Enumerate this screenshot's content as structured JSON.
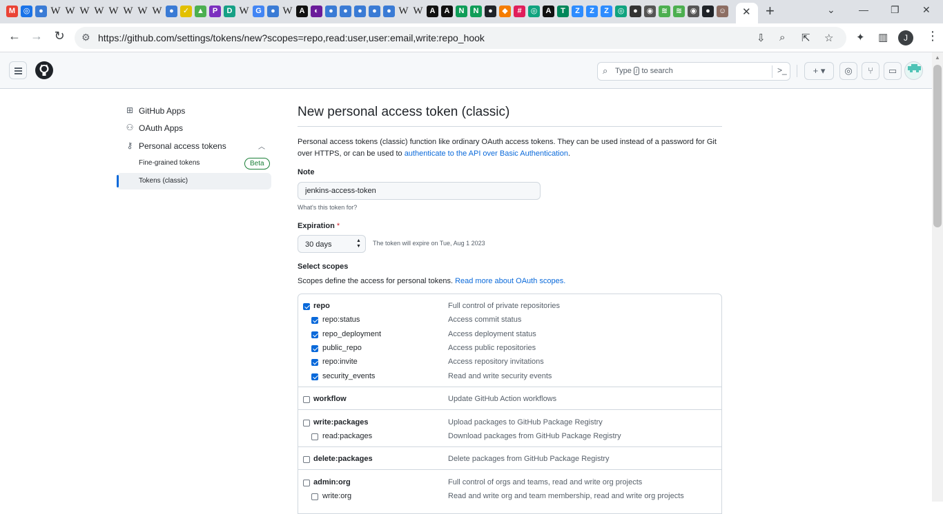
{
  "browser": {
    "url": "https://github.com/settings/tokens/new?scopes=repo,read:user,user:email,write:repo_hook",
    "favicons": [
      {
        "glyph": "M",
        "color": "#ea4335",
        "kind": "gmail"
      },
      {
        "glyph": "◎",
        "color": "#1a73e8",
        "kind": "circle"
      },
      {
        "glyph": "●",
        "color": "#3a7bd5",
        "kind": "app"
      },
      {
        "glyph": "W",
        "color": "#222",
        "kind": "wiki"
      },
      {
        "glyph": "W",
        "color": "#222",
        "kind": "wiki"
      },
      {
        "glyph": "W",
        "color": "#222",
        "kind": "wiki"
      },
      {
        "glyph": "W",
        "color": "#222",
        "kind": "wiki"
      },
      {
        "glyph": "W",
        "color": "#222",
        "kind": "wiki"
      },
      {
        "glyph": "W",
        "color": "#222",
        "kind": "wiki"
      },
      {
        "glyph": "W",
        "color": "#222",
        "kind": "wiki"
      },
      {
        "glyph": "W",
        "color": "#222",
        "kind": "wiki"
      },
      {
        "glyph": "●",
        "color": "#3a7bd5",
        "kind": "app"
      },
      {
        "glyph": "✓",
        "color": "#e2c000",
        "kind": "check"
      },
      {
        "glyph": "▲",
        "color": "#4caf50",
        "kind": "leaf"
      },
      {
        "glyph": "P",
        "color": "#7b2fbf",
        "kind": "app"
      },
      {
        "glyph": "D",
        "color": "#16a085",
        "kind": "app"
      },
      {
        "glyph": "W",
        "color": "#222",
        "kind": "wiki"
      },
      {
        "glyph": "G",
        "color": "#4285f4",
        "kind": "google"
      },
      {
        "glyph": "●",
        "color": "#3a7bd5",
        "kind": "app"
      },
      {
        "glyph": "W",
        "color": "#222",
        "kind": "wiki"
      },
      {
        "glyph": "A",
        "color": "#111",
        "kind": "app"
      },
      {
        "glyph": "◐",
        "color": "#6a1b9a",
        "kind": "app"
      },
      {
        "glyph": "●",
        "color": "#3a7bd5",
        "kind": "app"
      },
      {
        "glyph": "●",
        "color": "#3a7bd5",
        "kind": "app"
      },
      {
        "glyph": "●",
        "color": "#3a7bd5",
        "kind": "app"
      },
      {
        "glyph": "●",
        "color": "#3a7bd5",
        "kind": "app"
      },
      {
        "glyph": "●",
        "color": "#3a7bd5",
        "kind": "app"
      },
      {
        "glyph": "W",
        "color": "#222",
        "kind": "wiki"
      },
      {
        "glyph": "W",
        "color": "#222",
        "kind": "wiki"
      },
      {
        "glyph": "A",
        "color": "#111",
        "kind": "app"
      },
      {
        "glyph": "A",
        "color": "#111",
        "kind": "app"
      },
      {
        "glyph": "N",
        "color": "#0f9d58",
        "kind": "app"
      },
      {
        "glyph": "N",
        "color": "#0f9d58",
        "kind": "app"
      },
      {
        "glyph": "●",
        "color": "#1f2328",
        "kind": "github"
      },
      {
        "glyph": "◆",
        "color": "#f57c00",
        "kind": "app"
      },
      {
        "glyph": "#",
        "color": "#e01e5a",
        "kind": "app"
      },
      {
        "glyph": "◎",
        "color": "#10a37f",
        "kind": "app"
      },
      {
        "glyph": "A",
        "color": "#111",
        "kind": "app"
      },
      {
        "glyph": "T",
        "color": "#00875a",
        "kind": "app"
      },
      {
        "glyph": "Z",
        "color": "#2d8cff",
        "kind": "app"
      },
      {
        "glyph": "Z",
        "color": "#2d8cff",
        "kind": "app"
      },
      {
        "glyph": "Z",
        "color": "#2d8cff",
        "kind": "app"
      },
      {
        "glyph": "◎",
        "color": "#10a37f",
        "kind": "app"
      },
      {
        "glyph": "●",
        "color": "#333",
        "kind": "app"
      },
      {
        "glyph": "◉",
        "color": "#555",
        "kind": "app"
      },
      {
        "glyph": "≋",
        "color": "#4caf50",
        "kind": "app"
      },
      {
        "glyph": "≋",
        "color": "#4caf50",
        "kind": "app"
      },
      {
        "glyph": "◉",
        "color": "#555",
        "kind": "app"
      },
      {
        "glyph": "●",
        "color": "#1f2328",
        "kind": "github"
      },
      {
        "glyph": "☺",
        "color": "#8d6e63",
        "kind": "app"
      }
    ]
  },
  "header": {
    "search_prefix": "Type",
    "search_key": "/",
    "search_suffix": "to search",
    "create_label": "+ ▾"
  },
  "sidebar": {
    "items": [
      {
        "label": "GitHub Apps",
        "icon": "apps-icon"
      },
      {
        "label": "OAuth Apps",
        "icon": "person-icon"
      },
      {
        "label": "Personal access tokens",
        "icon": "key-icon"
      },
      {
        "label": "Fine-grained tokens",
        "badge": "Beta"
      },
      {
        "label": "Tokens (classic)",
        "active": true
      }
    ]
  },
  "main": {
    "title": "New personal access token (classic)",
    "description_text": "Personal access tokens (classic) function like ordinary OAuth access tokens. They can be used instead of a password for Git over HTTPS, or can be used to ",
    "description_link": "authenticate to the API over Basic Authentication",
    "description_end": ".",
    "note_label": "Note",
    "note_value": "jenkins-access-token",
    "note_hint": "What's this token for?",
    "expiration_label": "Expiration",
    "expiration_required": "*",
    "expiration_value": "30 days",
    "expiration_note": "The token will expire on Tue, Aug 1 2023",
    "scopes_label": "Select scopes",
    "scopes_desc": "Scopes define the access for personal tokens. ",
    "scopes_link": "Read more about OAuth scopes.",
    "scopes": [
      {
        "name": "repo",
        "desc": "Full control of private repositories",
        "checked": true,
        "bold": true
      },
      {
        "name": "repo:status",
        "desc": "Access commit status",
        "checked": true
      },
      {
        "name": "repo_deployment",
        "desc": "Access deployment status",
        "checked": true
      },
      {
        "name": "public_repo",
        "desc": "Access public repositories",
        "checked": true
      },
      {
        "name": "repo:invite",
        "desc": "Access repository invitations",
        "checked": true
      },
      {
        "name": "security_events",
        "desc": "Read and write security events",
        "checked": true
      },
      {
        "name": "workflow",
        "desc": "Update GitHub Action workflows",
        "checked": false,
        "bold": true
      },
      {
        "name": "write:packages",
        "desc": "Upload packages to GitHub Package Registry",
        "checked": false,
        "bold": true
      },
      {
        "name": "read:packages",
        "desc": "Download packages from GitHub Package Registry",
        "checked": false
      },
      {
        "name": "delete:packages",
        "desc": "Delete packages from GitHub Package Registry",
        "checked": false,
        "bold": true
      },
      {
        "name": "admin:org",
        "desc": "Full control of orgs and teams, read and write org projects",
        "checked": false,
        "bold": true
      },
      {
        "name": "write:org",
        "desc": "Read and write org and team membership, read and write org projects",
        "checked": false
      }
    ]
  },
  "colors": {
    "accent": "#0969da",
    "success": "#1a7f37",
    "danger": "#cf222e",
    "border": "#d0d7de"
  }
}
